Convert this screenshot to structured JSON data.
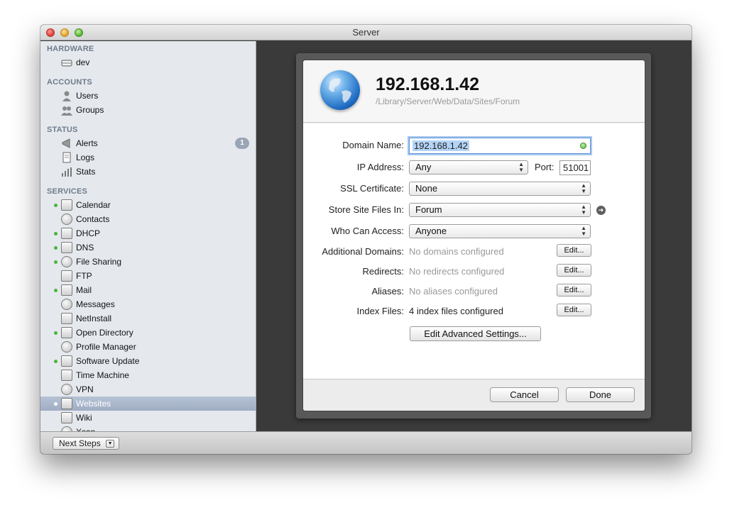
{
  "window": {
    "title": "Server"
  },
  "sidebar": {
    "sections": {
      "hardware": "HARDWARE",
      "accounts": "ACCOUNTS",
      "status": "STATUS",
      "services": "SERVICES"
    },
    "hardware_items": [
      {
        "label": "dev",
        "icon": "server-icon"
      }
    ],
    "account_items": [
      {
        "label": "Users",
        "icon": "user-icon"
      },
      {
        "label": "Groups",
        "icon": "group-icon"
      }
    ],
    "status_items": [
      {
        "label": "Alerts",
        "icon": "megaphone-icon",
        "badge": "1"
      },
      {
        "label": "Logs",
        "icon": "document-icon"
      },
      {
        "label": "Stats",
        "icon": "bar-chart-icon"
      }
    ],
    "service_items": [
      {
        "label": "Calendar",
        "icon": "calendar-icon",
        "running": true
      },
      {
        "label": "Contacts",
        "icon": "address-book-icon",
        "running": false
      },
      {
        "label": "DHCP",
        "icon": "dhcp-icon",
        "running": true
      },
      {
        "label": "DNS",
        "icon": "dns-icon",
        "running": true
      },
      {
        "label": "File Sharing",
        "icon": "folder-icon",
        "running": true
      },
      {
        "label": "FTP",
        "icon": "ftp-icon",
        "running": false
      },
      {
        "label": "Mail",
        "icon": "mail-icon",
        "running": true
      },
      {
        "label": "Messages",
        "icon": "chat-bubble-icon",
        "running": false
      },
      {
        "label": "NetInstall",
        "icon": "netinstall-icon",
        "running": false
      },
      {
        "label": "Open Directory",
        "icon": "directory-icon",
        "running": true
      },
      {
        "label": "Profile Manager",
        "icon": "gear-icon",
        "running": false
      },
      {
        "label": "Software Update",
        "icon": "update-icon",
        "running": true
      },
      {
        "label": "Time Machine",
        "icon": "clock-icon",
        "running": false
      },
      {
        "label": "VPN",
        "icon": "lock-icon",
        "running": false
      },
      {
        "label": "Websites",
        "icon": "globe-icon",
        "running": true,
        "selected": true
      },
      {
        "label": "Wiki",
        "icon": "wiki-icon",
        "running": false
      },
      {
        "label": "Xsan",
        "icon": "xsan-icon",
        "running": false
      }
    ]
  },
  "bottom": {
    "next_steps": "Next Steps"
  },
  "sheet": {
    "title": "192.168.1.42",
    "path": "/Library/Server/Web/Data/Sites/Forum",
    "labels": {
      "domain_name": "Domain Name:",
      "ip_address": "IP Address:",
      "port": "Port:",
      "ssl": "SSL Certificate:",
      "store": "Store Site Files In:",
      "who": "Who Can Access:",
      "additional": "Additional Domains:",
      "redirects": "Redirects:",
      "aliases": "Aliases:",
      "index": "Index Files:"
    },
    "values": {
      "domain_name": "192.168.1.42",
      "ip_address": "Any",
      "port": "51001",
      "ssl": "None",
      "store": "Forum",
      "who": "Anyone",
      "additional": "No domains configured",
      "redirects": "No redirects configured",
      "aliases": "No aliases configured",
      "index": "4 index files configured"
    },
    "edit_label": "Edit...",
    "advanced_button": "Edit Advanced Settings...",
    "cancel_button": "Cancel",
    "done_button": "Done"
  }
}
